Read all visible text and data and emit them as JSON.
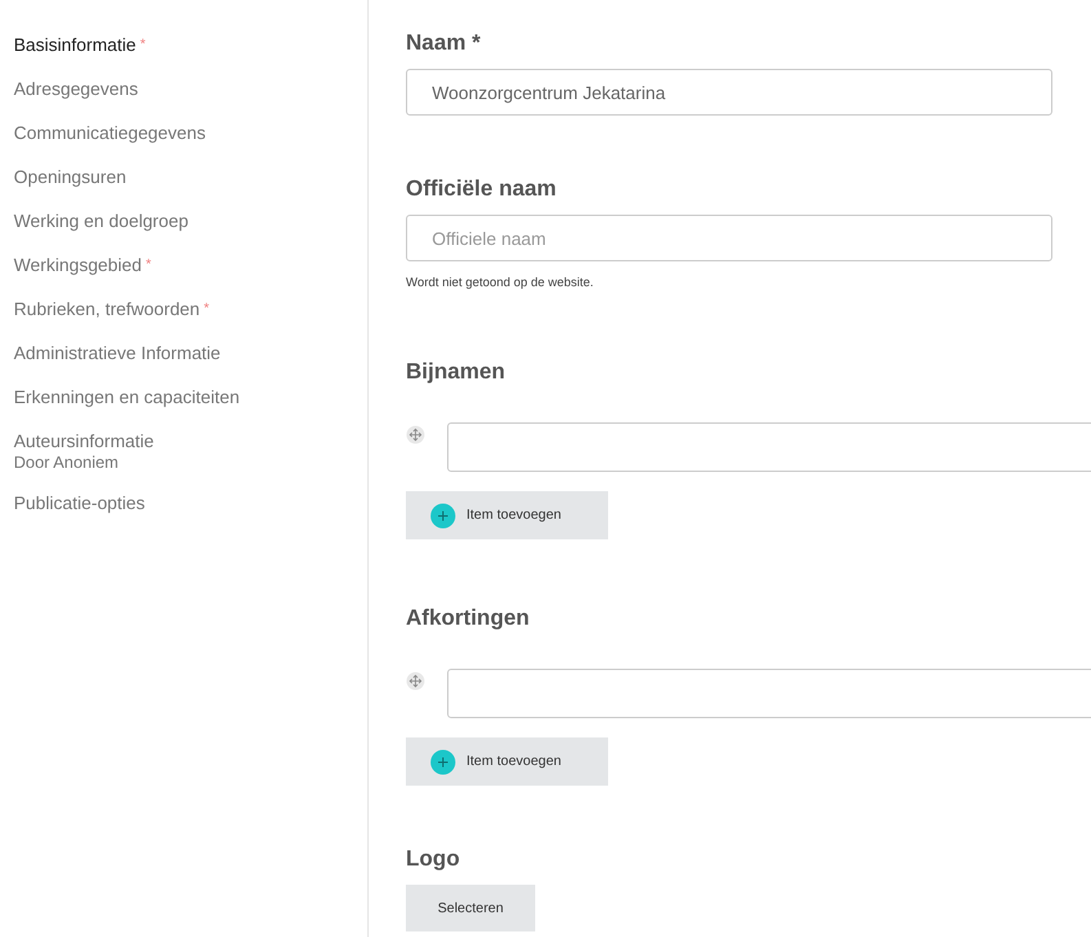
{
  "sidebar": {
    "items": [
      {
        "label": "Basisinformatie",
        "required_mark": "*",
        "selected": true
      },
      {
        "label": "Adresgegevens",
        "selected": false
      },
      {
        "label": "Communicatiegegevens",
        "selected": false
      },
      {
        "label": "Openingsuren",
        "selected": false
      },
      {
        "label": "Werking en doelgroep",
        "selected": false
      },
      {
        "label": "Werkingsgebied",
        "required_mark": "*",
        "selected": false
      },
      {
        "label": "Rubrieken, trefwoorden",
        "required_mark": "*",
        "selected": false
      },
      {
        "label": "Administratieve Informatie",
        "selected": false
      },
      {
        "label": "Erkenningen en capaciteiten",
        "selected": false
      },
      {
        "label": "Auteursinformatie",
        "sublabel": "Door Anoniem",
        "selected": false
      },
      {
        "label": "Publicatie-opties",
        "selected": false
      }
    ]
  },
  "sections": [
    {
      "kind": "text",
      "label": "Naam *",
      "value": "Woonzorgcentrum Jekatarina"
    },
    {
      "kind": "text",
      "label": "Officiële naam",
      "placeholder": "Officiele naam",
      "help": "Wordt niet getoond op de website."
    },
    {
      "kind": "list",
      "label": "Bijnamen",
      "add_button": "Item toevoegen"
    },
    {
      "kind": "list",
      "label": "Afkortingen",
      "add_button": "Item toevoegen"
    },
    {
      "kind": "file",
      "label": "Logo",
      "button": "Selecteren"
    }
  ]
}
